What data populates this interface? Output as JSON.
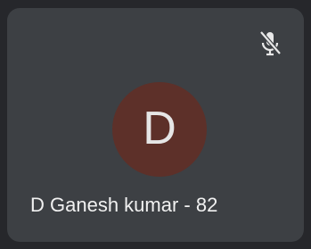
{
  "tile": {
    "avatar_letter": "D",
    "participant_name": "D Ganesh kumar - 82",
    "mic_icon": "mic-off-icon"
  },
  "colors": {
    "page_background": "#26272b",
    "tile_background": "#3d4044",
    "avatar_background": "#5d3029",
    "text": "#f1f1f1"
  }
}
